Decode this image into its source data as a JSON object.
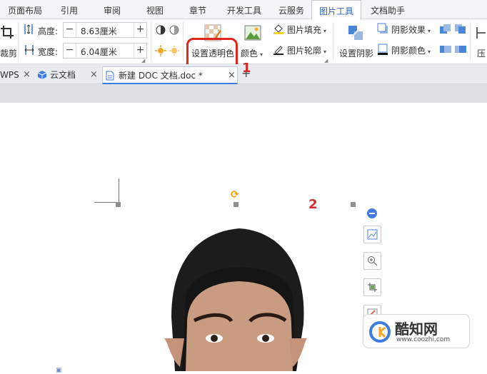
{
  "menu": {
    "items": [
      "页面布局",
      "引用",
      "审阅",
      "视图",
      "章节",
      "开发工具",
      "云服务",
      "图片工具",
      "文档助手"
    ],
    "active_index": 7
  },
  "ribbon": {
    "crop_label": "裁剪",
    "height_label": "高度:",
    "height_value": "8.63厘米",
    "width_label": "宽度:",
    "width_value": "6.04厘米",
    "set_transparent_label": "设置透明色",
    "color_label": "颜色",
    "fill_label": "图片填充",
    "outline_label": "图片轮廓",
    "set_shadow_label": "设置阴影",
    "shadow_effect_label": "阴影效果",
    "shadow_color_label": "阴影颜色",
    "compress_label": "压"
  },
  "tabs": {
    "wps_label": "WPS",
    "cloud_label": "云文档",
    "doc_label": "新建 DOC 文档.doc *"
  },
  "annotations": {
    "step1": "1",
    "step2": "2"
  },
  "watermark": {
    "brand": "酷知网",
    "url": "www.coozhi.com"
  },
  "colors": {
    "accent_blue": "#2b62b8",
    "annotation_red": "#e0261f",
    "menu_bg": "#f4f5f7"
  }
}
